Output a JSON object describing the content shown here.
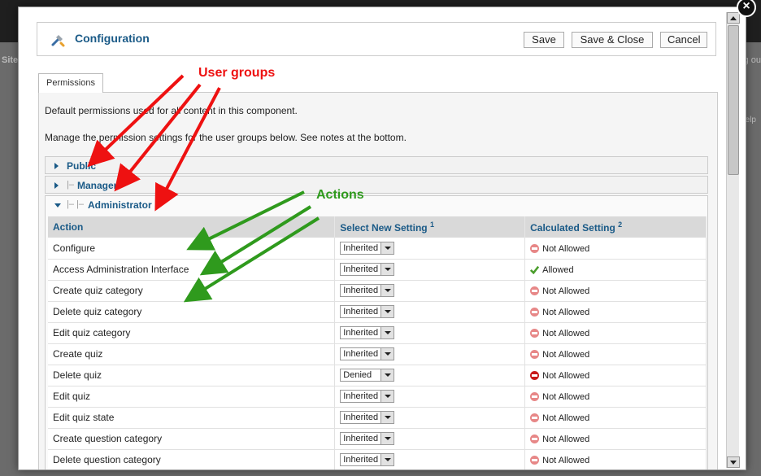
{
  "backdrop": {
    "left_text": "Site",
    "right_text": "g ou",
    "help_text": "elp"
  },
  "modal": {
    "close_label": "×",
    "title": "Configuration",
    "toolbar": {
      "save_label": "Save",
      "save_close_label": "Save & Close",
      "cancel_label": "Cancel"
    },
    "tab_label": "Permissions",
    "intro_1": "Default permissions used for all content in this component.",
    "intro_2": "Manage the permission settings for the user groups below. See notes at the bottom.",
    "groups": [
      {
        "label": "Public",
        "prefix": "",
        "expanded": false
      },
      {
        "label": "Manager",
        "prefix": "|–",
        "expanded": false
      },
      {
        "label": "Administrator",
        "prefix": "|– |–",
        "expanded": true
      }
    ],
    "table": {
      "headers": {
        "action": "Action",
        "select": "Select New Setting",
        "select_note": "1",
        "calculated": "Calculated Setting",
        "calculated_note": "2"
      },
      "rows": [
        {
          "action": "Configure",
          "setting": "Inherited",
          "calc": "Not Allowed",
          "status": "na"
        },
        {
          "action": "Access Administration Interface",
          "setting": "Inherited",
          "calc": "Allowed",
          "status": "ok"
        },
        {
          "action": "Create quiz category",
          "setting": "Inherited",
          "calc": "Not Allowed",
          "status": "na"
        },
        {
          "action": "Delete quiz category",
          "setting": "Inherited",
          "calc": "Not Allowed",
          "status": "na"
        },
        {
          "action": "Edit quiz category",
          "setting": "Inherited",
          "calc": "Not Allowed",
          "status": "na"
        },
        {
          "action": "Create quiz",
          "setting": "Inherited",
          "calc": "Not Allowed",
          "status": "na"
        },
        {
          "action": "Delete quiz",
          "setting": "Denied",
          "calc": "Not Allowed",
          "status": "denied"
        },
        {
          "action": "Edit quiz",
          "setting": "Inherited",
          "calc": "Not Allowed",
          "status": "na"
        },
        {
          "action": "Edit quiz state",
          "setting": "Inherited",
          "calc": "Not Allowed",
          "status": "na"
        },
        {
          "action": "Create question category",
          "setting": "Inherited",
          "calc": "Not Allowed",
          "status": "na"
        },
        {
          "action": "Delete question category",
          "setting": "Inherited",
          "calc": "Not Allowed",
          "status": "na"
        }
      ]
    }
  },
  "annotations": {
    "user_groups": "User groups",
    "actions": "Actions"
  },
  "colors": {
    "link_blue": "#1a5a87",
    "annotation_red": "#e11111",
    "annotation_green": "#2f9a1d",
    "allowed_green": "#4a9d2b",
    "denied_red": "#c81a1a",
    "not_allowed_red": "#e78787"
  }
}
